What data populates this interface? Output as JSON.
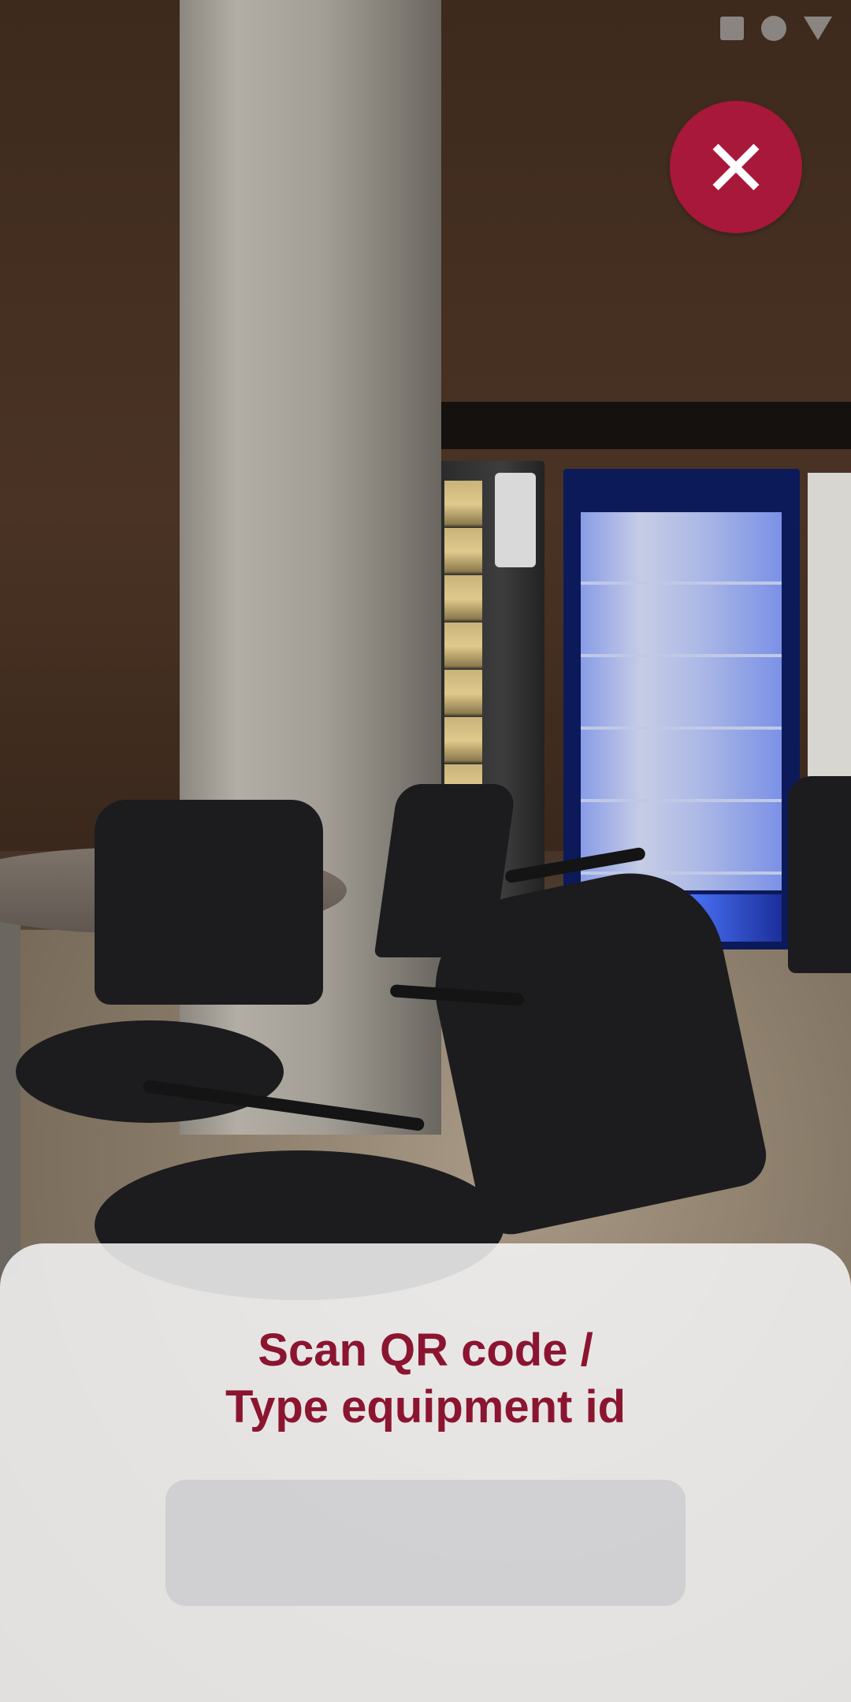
{
  "screen": {
    "name": "qr-scanner"
  },
  "system_nav": {
    "icons": [
      "recents-square-icon",
      "home-circle-icon",
      "back-triangle-icon"
    ],
    "color": "#8a8580"
  },
  "close_button": {
    "icon": "close-icon",
    "background_color": "#a8183a",
    "icon_color": "#ffffff"
  },
  "scan_prompt": {
    "line1": "Scan QR code /",
    "line2": "Type equipment id",
    "text_color": "#8b1530"
  },
  "equipment_input": {
    "value": "",
    "placeholder": ""
  },
  "bottom_sheet": {
    "background_color": "#f6f6f7"
  }
}
